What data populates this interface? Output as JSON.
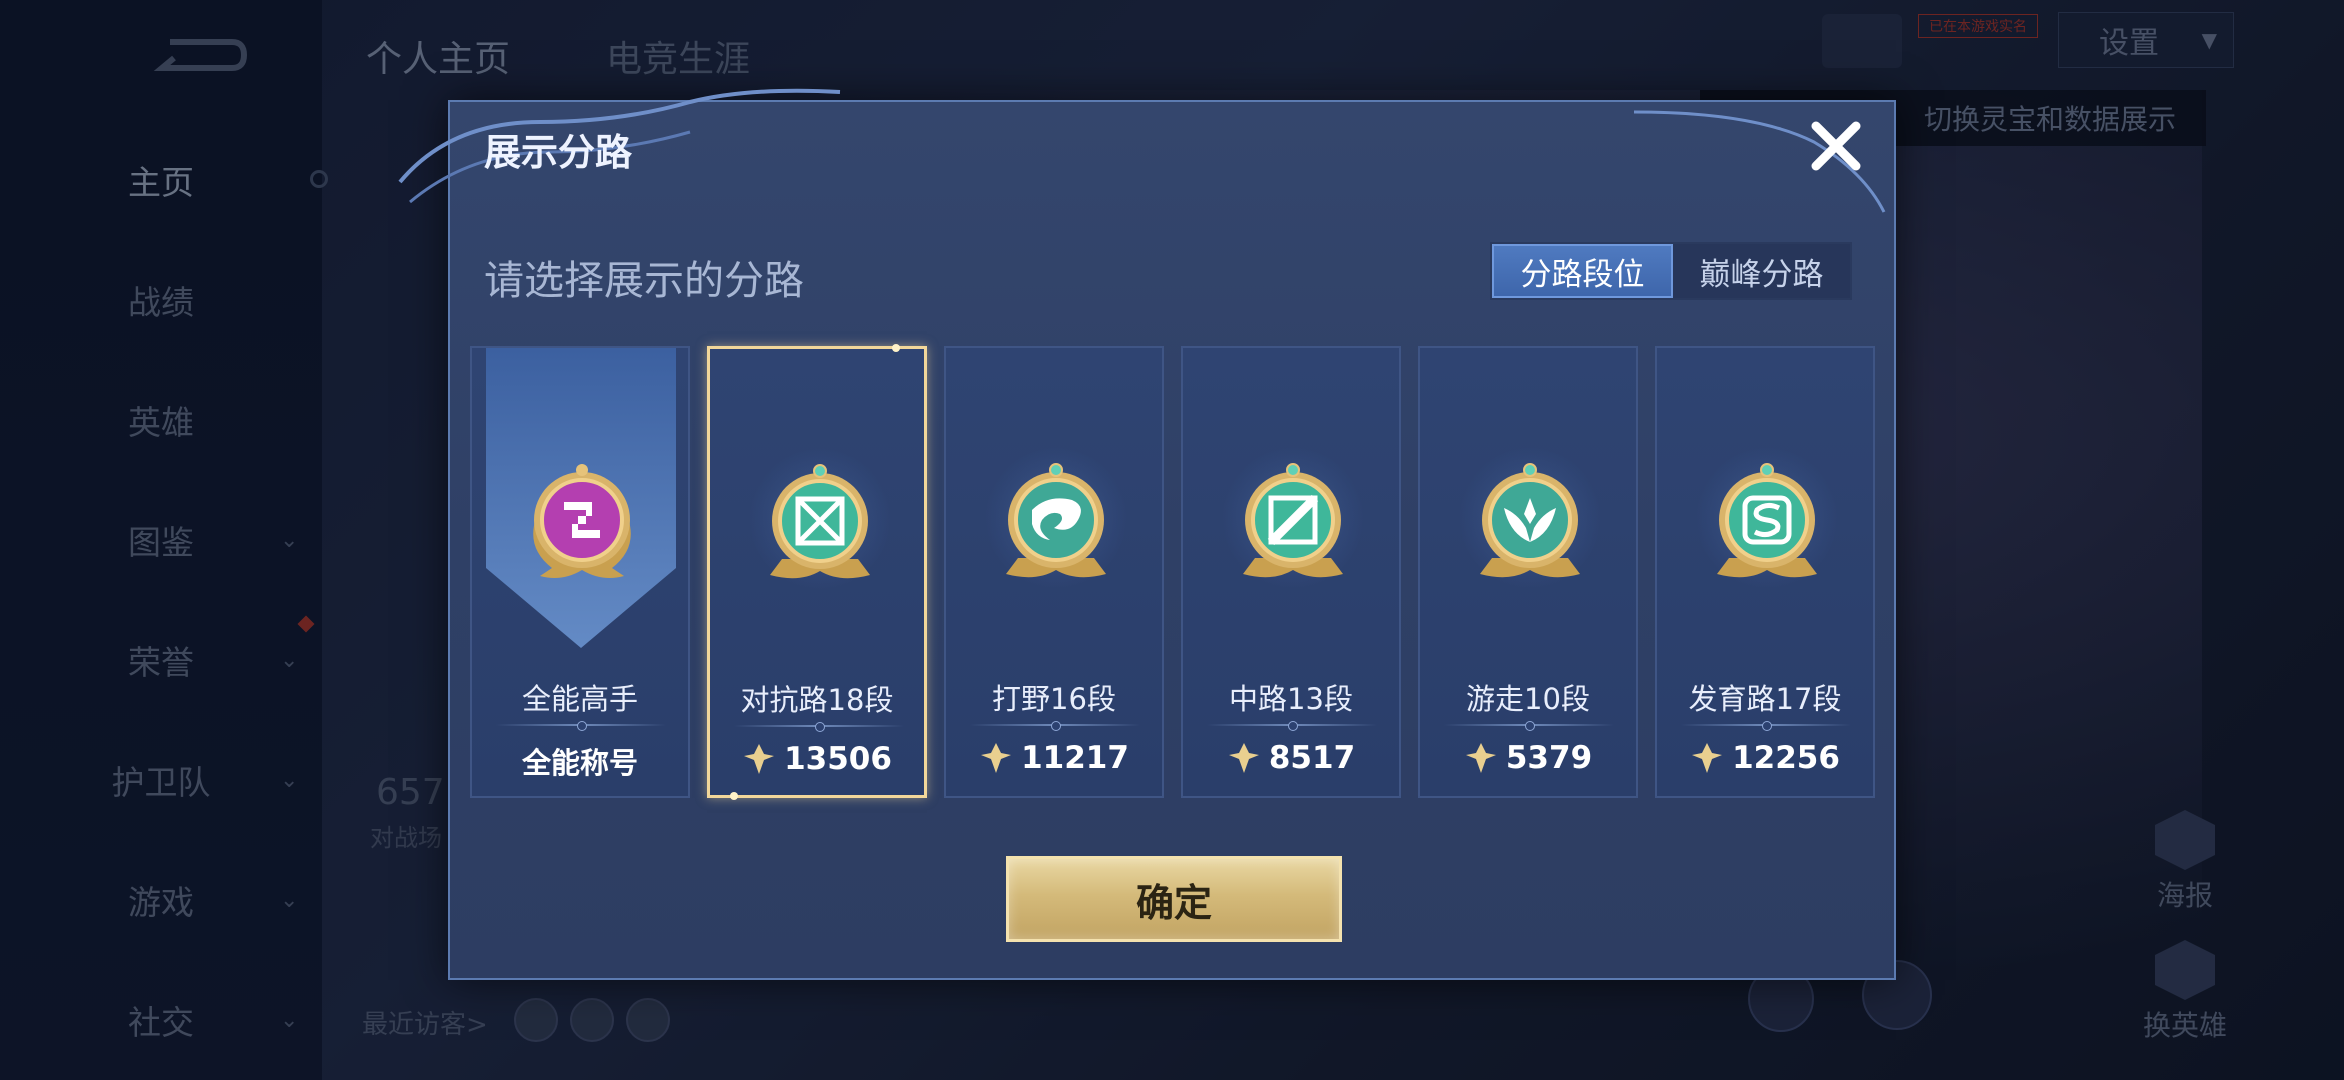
{
  "sidebar": {
    "items": [
      {
        "label": "主页",
        "active": true
      },
      {
        "label": "战绩"
      },
      {
        "label": "英雄"
      },
      {
        "label": "图鉴",
        "has_chevron": true
      },
      {
        "label": "荣誉",
        "has_chevron": true
      },
      {
        "label": "护卫队",
        "has_chevron": true
      },
      {
        "label": "游戏",
        "has_chevron": true
      },
      {
        "label": "社交",
        "has_chevron": true
      }
    ]
  },
  "header": {
    "tabs": [
      {
        "label": "个人主页",
        "active": true
      },
      {
        "label": "电竞生涯"
      }
    ],
    "badge": "已在本游戏实名",
    "settings_label": "设置",
    "tip": "切换灵宝和数据展示"
  },
  "background": {
    "stat_value": "657",
    "stat_label": "对战场",
    "visitors_label": "最近访客>",
    "poster_label": "海报",
    "change_hero_label": "换英雄"
  },
  "modal": {
    "title": "展示分路",
    "subtitle": "请选择展示的分路",
    "segments": [
      {
        "label": "分路段位",
        "active": true
      },
      {
        "label": "巅峰分路",
        "active": false
      }
    ],
    "cards": [
      {
        "name": "全能高手",
        "bottom": "全能称号",
        "emblem": "all-round-emblem-icon",
        "color": "#b43fb0"
      },
      {
        "name": "对抗路18段",
        "score": "13506",
        "emblem": "clash-lane-emblem-icon",
        "selected": true,
        "color": "#3fb79a"
      },
      {
        "name": "打野16段",
        "score": "11217",
        "emblem": "jungle-dragon-emblem-icon",
        "color": "#3fa896"
      },
      {
        "name": "中路13段",
        "score": "8517",
        "emblem": "mid-lane-emblem-icon",
        "color": "#3fb79a"
      },
      {
        "name": "游走10段",
        "score": "5379",
        "emblem": "roam-wings-emblem-icon",
        "color": "#3fa896"
      },
      {
        "name": "发育路17段",
        "score": "12256",
        "emblem": "farm-lane-emblem-icon",
        "color": "#3fb79a"
      }
    ],
    "confirm_label": "确定"
  },
  "colors": {
    "accent_gold": "#f2d79a",
    "segment_active": "#4f7ac0",
    "modal_bg": "#33456b"
  }
}
